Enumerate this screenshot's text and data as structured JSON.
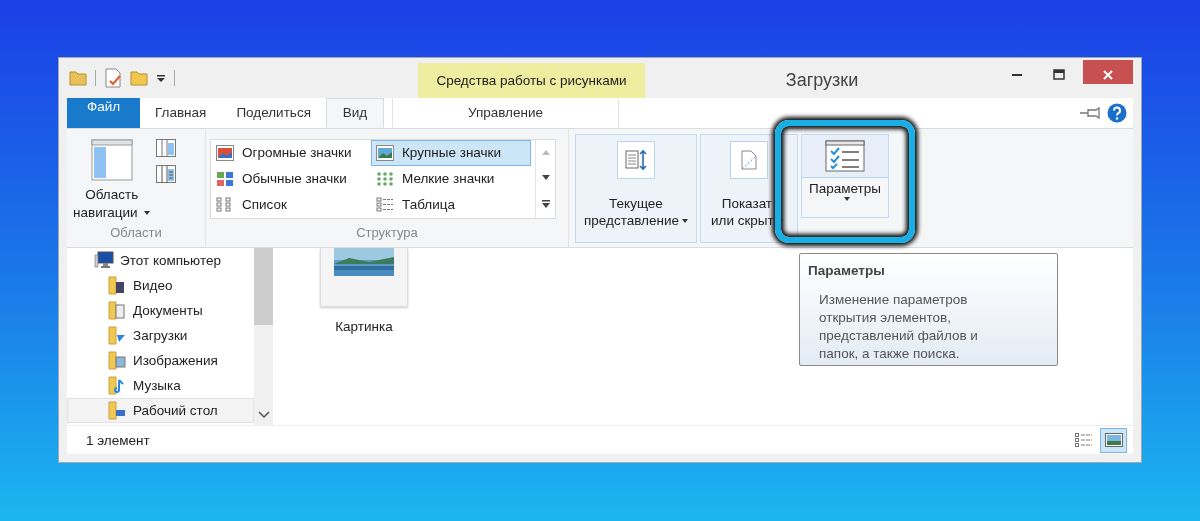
{
  "window": {
    "title": "Загрузки"
  },
  "contextual_group": {
    "label": "Средства работы с рисунками"
  },
  "tabs": [
    {
      "label": "Файл",
      "kind": "file",
      "selected": false
    },
    {
      "label": "Главная",
      "kind": "normal",
      "selected": false
    },
    {
      "label": "Поделиться",
      "kind": "normal",
      "selected": false
    },
    {
      "label": "Вид",
      "kind": "normal",
      "selected": true
    },
    {
      "label": "Управление",
      "kind": "contextual",
      "selected": false
    }
  ],
  "ribbon": {
    "panes_group": {
      "label": "Области",
      "button_lines": [
        "Область",
        "навигации"
      ]
    },
    "layout_group": {
      "label": "Структура",
      "items": [
        {
          "label": "Огромные значки",
          "kind": "huge",
          "selected": false
        },
        {
          "label": "Крупные значки",
          "kind": "large",
          "selected": true
        },
        {
          "label": "Обычные значки",
          "kind": "medium",
          "selected": false
        },
        {
          "label": "Мелкие значки",
          "kind": "small",
          "selected": false
        },
        {
          "label": "Список",
          "kind": "list",
          "selected": false
        },
        {
          "label": "Таблица",
          "kind": "details",
          "selected": false
        }
      ]
    },
    "buttons": [
      {
        "lines": [
          "Текущее",
          "представление"
        ],
        "kind": "current_view",
        "highlighted": false
      },
      {
        "lines": [
          "Показат",
          "или скрыт"
        ],
        "kind": "show_hide",
        "highlighted": false
      },
      {
        "lines": [
          "Параметры"
        ],
        "kind": "options",
        "highlighted": true
      }
    ]
  },
  "sidebar": {
    "items": [
      {
        "label": "Этот компьютер",
        "kind": "computer",
        "hover": false,
        "children": [
          {
            "label": "Видео",
            "kind": "video",
            "hover": false
          },
          {
            "label": "Документы",
            "kind": "documents",
            "hover": false
          },
          {
            "label": "Загрузки",
            "kind": "downloads",
            "hover": false
          },
          {
            "label": "Изображения",
            "kind": "pictures",
            "hover": false
          },
          {
            "label": "Музыка",
            "kind": "music",
            "hover": false
          },
          {
            "label": "Рабочий стол",
            "kind": "desktop",
            "hover": true
          }
        ]
      }
    ]
  },
  "files": [
    {
      "name": "Картинка",
      "kind": "picture"
    }
  ],
  "tooltip": {
    "title": "Параметры",
    "lines": [
      "Изменение параметров",
      "открытия элементов,",
      "представлений файлов и",
      "папок, а также поиска."
    ]
  },
  "status_bar": {
    "text": "1 элемент",
    "views": [
      {
        "kind": "details",
        "selected": false
      },
      {
        "kind": "large_icons",
        "selected": true
      }
    ]
  }
}
